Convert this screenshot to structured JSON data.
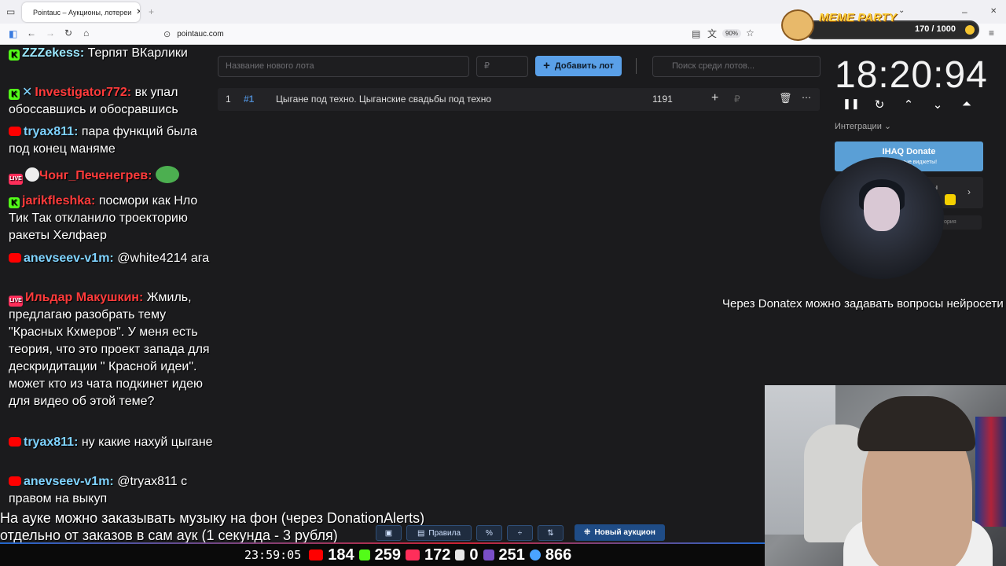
{
  "browser": {
    "tab_title": "Pointauc – Аукционы, лотереи",
    "url": "pointauc.com",
    "zoom": "90%"
  },
  "meme": {
    "title": "MEME PARTY",
    "count": "170 / 1000"
  },
  "chat": [
    {
      "nick": "ZZZekess:",
      "text": " Терпят ВКарлики",
      "nick_color": "#9be7ff"
    },
    {
      "nick": "Investigator772:",
      "text": " вк упал обоссавшись и обосравшись",
      "nick_color": "#ff3b3b"
    },
    {
      "nick": "tryax811:",
      "text": " пара функций была под конец маняме",
      "nick_color": "#7fd3ff"
    },
    {
      "nick": "Чонг_Печенегрев:",
      "text": "",
      "nick_color": "#ff3b3b"
    },
    {
      "nick": "jarikfleshka:",
      "text": " посмори как Нло Тик Так откланило троекторию ракеты Хелфаер",
      "nick_color": "#ff3b3b"
    },
    {
      "nick": "anevseev-v1m:",
      "text": " @white4214 ага",
      "nick_color": "#7fd3ff"
    },
    {
      "nick": "Ильдар Макушкин:",
      "text": " Жмиль, предлагаю разобрать тему \"Красных Кхмеров\". У меня есть теория, что это проект запада для дескридитации \" Красной идеи\". может кто из чата подкинет идею для видео об этой теме?",
      "nick_color": "#ff3b3b"
    },
    {
      "nick": "tryax811:",
      "text": " ну какие нахуй цыгане",
      "nick_color": "#7fd3ff"
    },
    {
      "nick": "anevseev-v1m:",
      "text": " @tryax811 с правом на выкуп",
      "nick_color": "#7fd3ff"
    }
  ],
  "app": {
    "lot_placeholder": "Название нового лота",
    "price_placeholder": "₽",
    "add_button": "Добавить лот",
    "search_placeholder": "Поиск среди лотов...",
    "lot": {
      "index": "1",
      "tag": "#1",
      "name": "Цыгане под техно. Цыганские свадьбы под техно",
      "amount": "1191",
      "currency": "₽"
    }
  },
  "timer": {
    "value": "18:20:94",
    "integrations_label": "Интеграции",
    "ihaq_title": "IHAQ Donate",
    "ihaq_sub": "уникальные виджеты!",
    "services_label": "исы",
    "history_label": "тория"
  },
  "overlay": {
    "donatex_text": "Через Donatex можно задавать вопросы нейросети",
    "music_line1": "На ауке можно заказывать музыку на фон (через DonationAlerts)",
    "music_line2": "отдельно от заказов в сам аук (1 секунда - 3 рубля)"
  },
  "toolbar": {
    "rules": "Правила",
    "new_auction": "Новый аукцион"
  },
  "stats": {
    "clock": "23:59:05",
    "youtube": "184",
    "kick": "259",
    "vk": "172",
    "rumble": "0",
    "other": "251",
    "viewers": "866"
  },
  "colors": {
    "accent": "#5aa0e8",
    "youtube": "#ff0000",
    "kick": "#53fc18",
    "vk": "#ff2e5a"
  }
}
